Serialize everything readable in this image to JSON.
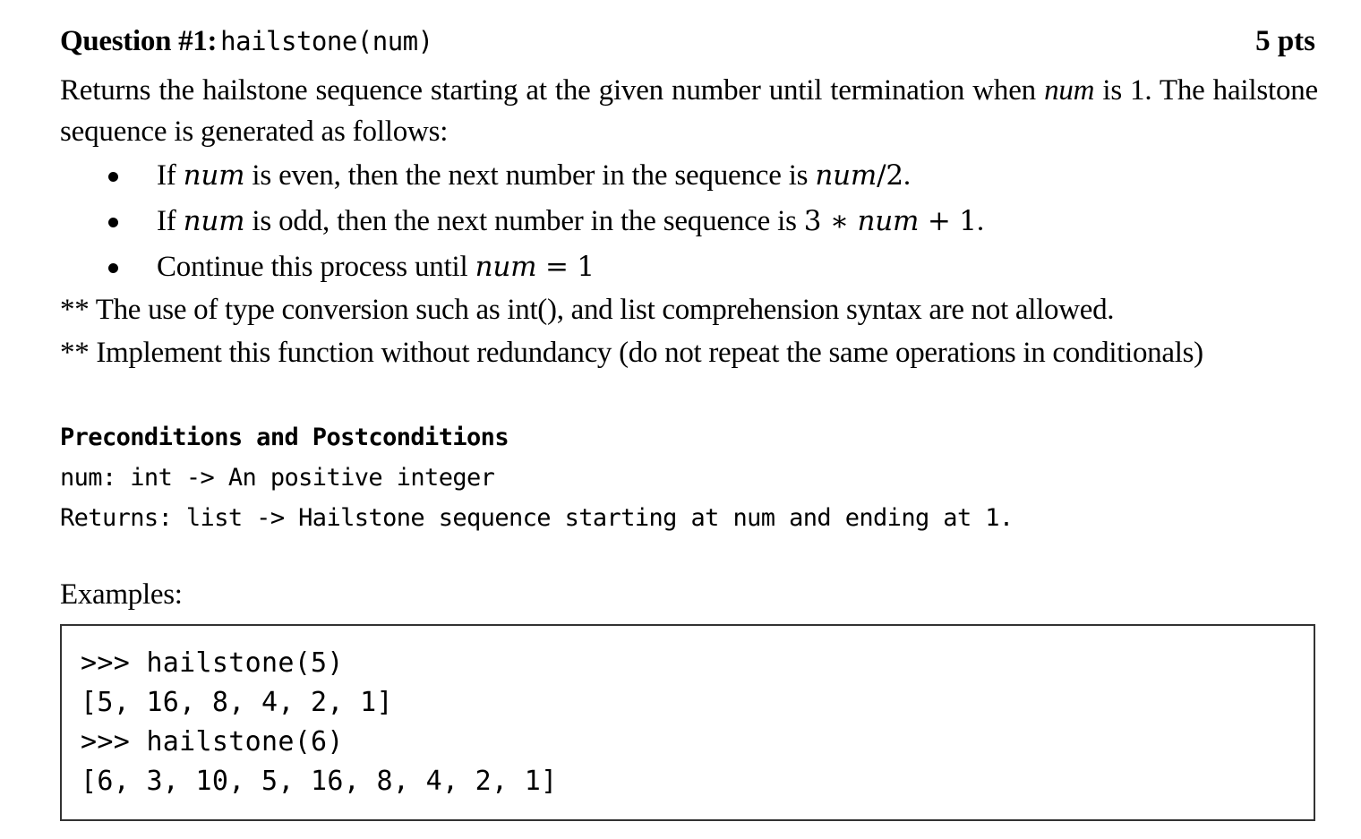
{
  "question": {
    "label": "Question #1:",
    "function_signature": "hailstone(num)",
    "points": "5 pts"
  },
  "description": {
    "line1_part1": "Returns the hailstone sequence starting at the given number until termination when ",
    "line1_var": "num",
    "line1_part2": " is 1. The hailstone sequence is generated as follows:"
  },
  "rules": [
    {
      "prefix": "If ",
      "var": "num",
      "middle": " is even, then the next number in the sequence is ",
      "expr_var": "num",
      "expr_rest": "/2",
      "suffix": "."
    },
    {
      "prefix": "If ",
      "var": "num",
      "middle": " is odd, then the next number in the sequence is ",
      "expr_pre": "3 ∗ ",
      "expr_var": "num",
      "expr_rest": " + 1",
      "suffix": "."
    },
    {
      "prefix": "Continue this process until ",
      "expr_var": "num",
      "expr_rest": " = 1"
    }
  ],
  "notes": [
    "** The use of type conversion such as int(), and list comprehension syntax are not allowed.",
    "** Implement this function without redundancy (do not repeat the same operations in conditionals)"
  ],
  "conditions": {
    "heading": "Preconditions and Postconditions",
    "precondition": "num: int -> An positive integer",
    "postcondition": "Returns: list -> Hailstone sequence starting at num and ending at 1."
  },
  "examples": {
    "label": "Examples:",
    "lines": [
      ">>> hailstone(5)",
      "[5, 16, 8, 4, 2, 1]",
      ">>> hailstone(6)",
      "[6, 3, 10, 5, 16, 8, 4, 2, 1]"
    ]
  }
}
